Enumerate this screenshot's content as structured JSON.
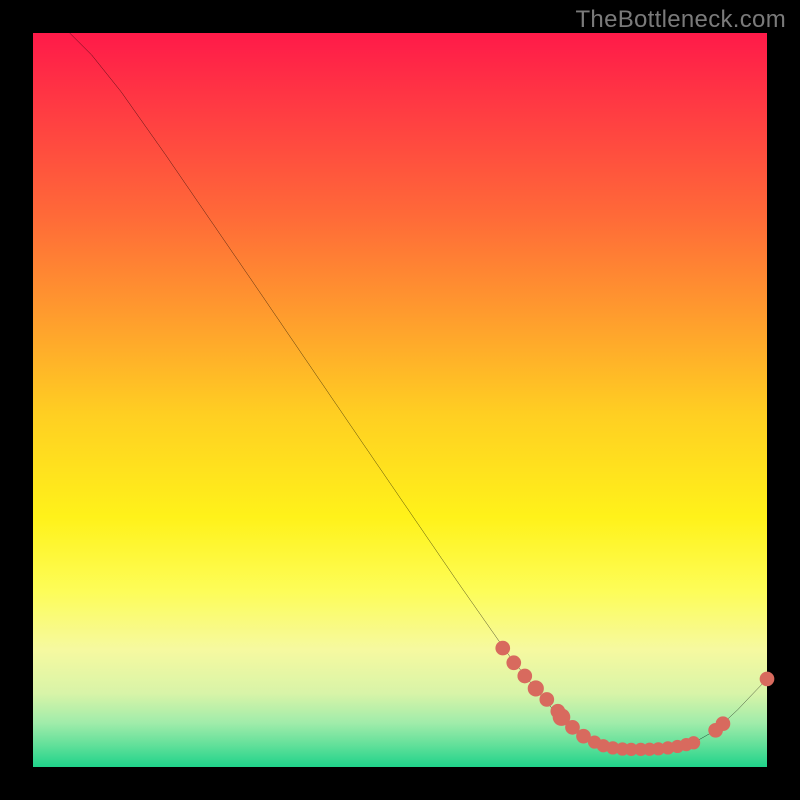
{
  "watermark": "TheBottleneck.com",
  "chart_data": {
    "type": "line",
    "title": "",
    "xlabel": "",
    "ylabel": "",
    "xlim": [
      0,
      100
    ],
    "ylim": [
      0,
      100
    ],
    "curve": [
      {
        "x": 5,
        "y": 100
      },
      {
        "x": 8,
        "y": 97
      },
      {
        "x": 12,
        "y": 92
      },
      {
        "x": 18,
        "y": 83.5
      },
      {
        "x": 30,
        "y": 66
      },
      {
        "x": 45,
        "y": 44
      },
      {
        "x": 58,
        "y": 25
      },
      {
        "x": 65,
        "y": 15
      },
      {
        "x": 69,
        "y": 10
      },
      {
        "x": 72,
        "y": 6.5
      },
      {
        "x": 75,
        "y": 4
      },
      {
        "x": 78,
        "y": 2.8
      },
      {
        "x": 81,
        "y": 2.4
      },
      {
        "x": 84,
        "y": 2.4
      },
      {
        "x": 87,
        "y": 2.7
      },
      {
        "x": 90,
        "y": 3.3
      },
      {
        "x": 93,
        "y": 5.0
      },
      {
        "x": 96,
        "y": 7.8
      },
      {
        "x": 100,
        "y": 12
      }
    ],
    "markers": [
      {
        "x": 64,
        "y": 16.2,
        "r": 1.0
      },
      {
        "x": 65.5,
        "y": 14.2,
        "r": 1.0
      },
      {
        "x": 67,
        "y": 12.4,
        "r": 1.0
      },
      {
        "x": 68.5,
        "y": 10.7,
        "r": 1.1
      },
      {
        "x": 70,
        "y": 9.2,
        "r": 1.0
      },
      {
        "x": 71.5,
        "y": 7.6,
        "r": 1.0
      },
      {
        "x": 72,
        "y": 6.8,
        "r": 1.2
      },
      {
        "x": 73.5,
        "y": 5.4,
        "r": 1.0
      },
      {
        "x": 75,
        "y": 4.2,
        "r": 1.0
      },
      {
        "x": 76.5,
        "y": 3.4,
        "r": 0.9
      },
      {
        "x": 77.7,
        "y": 2.9,
        "r": 0.9
      },
      {
        "x": 79,
        "y": 2.6,
        "r": 0.9
      },
      {
        "x": 80.3,
        "y": 2.45,
        "r": 0.9
      },
      {
        "x": 81.5,
        "y": 2.4,
        "r": 0.9
      },
      {
        "x": 82.8,
        "y": 2.4,
        "r": 0.9
      },
      {
        "x": 84,
        "y": 2.42,
        "r": 0.9
      },
      {
        "x": 85.2,
        "y": 2.48,
        "r": 0.9
      },
      {
        "x": 86.5,
        "y": 2.6,
        "r": 0.9
      },
      {
        "x": 87.8,
        "y": 2.8,
        "r": 0.9
      },
      {
        "x": 89,
        "y": 3.05,
        "r": 0.9
      },
      {
        "x": 90,
        "y": 3.3,
        "r": 0.9
      },
      {
        "x": 93,
        "y": 5.0,
        "r": 1.0
      },
      {
        "x": 94,
        "y": 5.9,
        "r": 1.0
      },
      {
        "x": 100,
        "y": 12,
        "r": 1.0
      }
    ],
    "colors": {
      "curve_stroke": "#000000",
      "marker_fill": "#d86a5e"
    }
  }
}
